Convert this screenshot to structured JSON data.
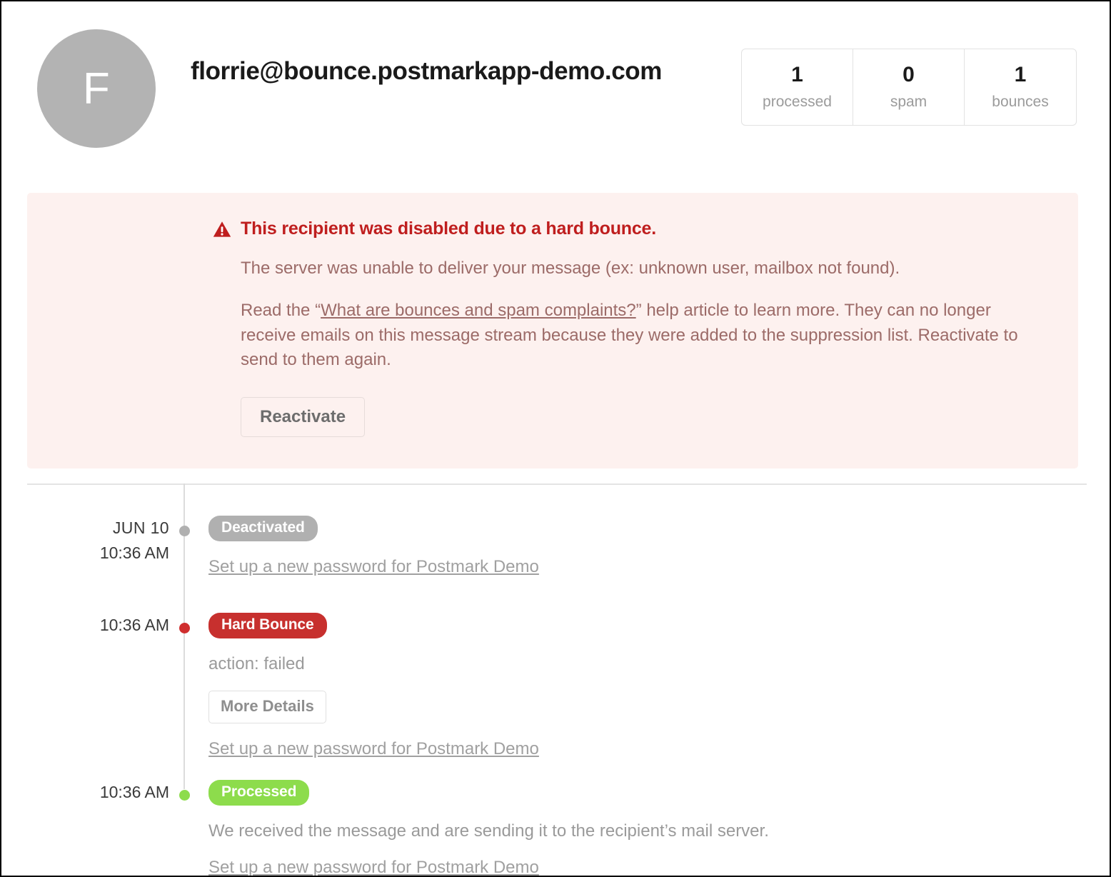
{
  "header": {
    "avatar_initial": "F",
    "email": "florrie@bounce.postmarkapp-demo.com",
    "stats": [
      {
        "value": "1",
        "label": "processed"
      },
      {
        "value": "0",
        "label": "spam"
      },
      {
        "value": "1",
        "label": "bounces"
      }
    ]
  },
  "alert": {
    "icon": "warning-triangle-icon",
    "title": "This recipient was disabled due to a hard bounce.",
    "paragraph_1": "The server was unable to deliver your message (ex: unknown user, mailbox not found).",
    "paragraph_2_before": "Read the “",
    "paragraph_2_link": "What are bounces and spam complaints?",
    "paragraph_2_after": "” help article to learn more. They can no longer receive emails on this message stream because they were added to the suppression list. Reactivate to send to them again.",
    "reactivate_label": "Reactivate"
  },
  "timeline": {
    "events": [
      {
        "date": "JUN 10",
        "time": "10:36 AM",
        "badge": "Deactivated",
        "subject": "Set up a new password for Postmark Demo"
      },
      {
        "time": "10:36 AM",
        "badge": "Hard Bounce",
        "description": "action: failed",
        "more_details_label": "More Details",
        "subject": "Set up a new password for Postmark Demo"
      },
      {
        "time": "10:36 AM",
        "badge": "Processed",
        "description": "We received the message and are sending it to the recipient’s mail server.",
        "subject": "Set up a new password for Postmark Demo"
      }
    ]
  },
  "colors": {
    "alert_background": "#fdf1ef",
    "alert_title": "#bf1e1e",
    "alert_text": "#9c6b68",
    "badge_gray": "#b0b0b0",
    "badge_red": "#c7302e",
    "badge_green": "#8ddc4c",
    "avatar": "#b3b3b3"
  }
}
